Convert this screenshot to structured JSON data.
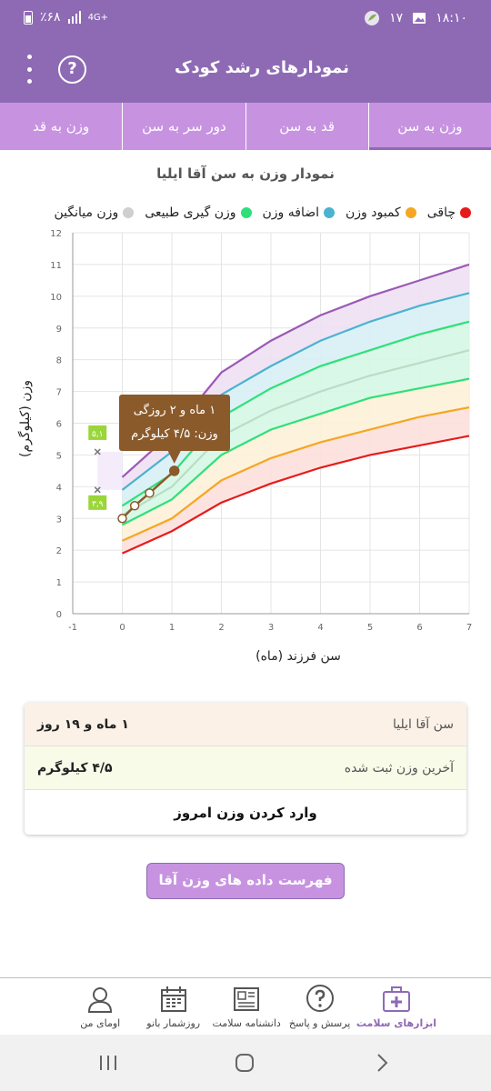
{
  "status_bar": {
    "time": "۱۸:۱۰",
    "date_num": "۱۷",
    "battery": "٪۶۸",
    "network": "4G+"
  },
  "app_bar": {
    "title": "نمودارهای رشد کودک"
  },
  "tabs": [
    {
      "label": "وزن به سن",
      "active": true
    },
    {
      "label": "قد به سن",
      "active": false
    },
    {
      "label": "دور سر به سن",
      "active": false
    },
    {
      "label": "وزن به قد",
      "active": false
    }
  ],
  "chart_title": "نمودار وزن به سن آقا ایلیا",
  "legend": [
    {
      "label": "چاقی",
      "color": "#e51c1c"
    },
    {
      "label": "کمبود وزن",
      "color": "#f5a623"
    },
    {
      "label": "اضافه وزن",
      "color": "#4ab3d0"
    },
    {
      "label": "وزن گیری طبیعی",
      "color": "#2ee07a"
    },
    {
      "label": "وزن میانگین",
      "color": "#cfcfcf"
    }
  ],
  "chart_data": {
    "type": "line",
    "xlabel": "سن فرزند (ماه)",
    "ylabel": "وزن (کیلوگرم)",
    "xlim": [
      -1,
      7
    ],
    "ylim": [
      0,
      12
    ],
    "x_ticks": [
      "-1",
      "0",
      "1",
      "2",
      "3",
      "4",
      "5",
      "6",
      "7"
    ],
    "y_ticks": [
      "0",
      "1",
      "2",
      "3",
      "4",
      "5",
      "6",
      "7",
      "8",
      "9",
      "10",
      "11",
      "12"
    ],
    "x": [
      0,
      1,
      2,
      3,
      4,
      5,
      6,
      7
    ],
    "series": [
      {
        "color": "#9b59b6",
        "values": [
          4.3,
          5.7,
          7.6,
          8.6,
          9.4,
          10.0,
          10.5,
          11.0
        ]
      },
      {
        "color": "#4ab3d0",
        "values": [
          3.9,
          5.1,
          6.9,
          7.8,
          8.6,
          9.2,
          9.7,
          10.1
        ]
      },
      {
        "color": "#2ee07a",
        "values": [
          3.4,
          4.4,
          6.2,
          7.1,
          7.8,
          8.3,
          8.8,
          9.2
        ]
      },
      {
        "color": "#b9ddc6",
        "values": [
          3.1,
          4.0,
          5.6,
          6.4,
          7.0,
          7.5,
          7.9,
          8.3
        ]
      },
      {
        "color": "#2ee07a",
        "values": [
          2.8,
          3.6,
          5.0,
          5.8,
          6.3,
          6.8,
          7.1,
          7.4
        ]
      },
      {
        "color": "#f5a623",
        "values": [
          2.3,
          3.0,
          4.2,
          4.9,
          5.4,
          5.8,
          6.2,
          6.5
        ]
      },
      {
        "color": "#e51c1c",
        "values": [
          1.9,
          2.6,
          3.5,
          4.1,
          4.6,
          5.0,
          5.3,
          5.6
        ]
      }
    ],
    "band_fills": [
      "#ede0f3",
      "#d8eff5",
      "#d6f7e4",
      "#d6f7e4",
      "#fdf1d8",
      "#fde0dc"
    ],
    "child_series": {
      "color": "#8b5a2b",
      "x": [
        0,
        0.25,
        0.55,
        1.05
      ],
      "values": [
        3.0,
        3.4,
        3.8,
        4.5
      ]
    },
    "birth_range": {
      "low": 3.9,
      "high": 5.1,
      "low_label": "۳,۹",
      "high_label": "۵,۱"
    },
    "tooltip": {
      "line1": "۱ ماه و ۲ روزگی",
      "line2": "وزن: ۴/۵ کیلوگرم"
    }
  },
  "info": {
    "age_label": "سن آقا ایلیا",
    "age_value": "۱ ماه و ۱۹ روز",
    "weight_label": "آخرین وزن ثبت شده",
    "weight_value": "۴/۵ کیلوگرم",
    "enter_button": "وارد کردن وزن امروز"
  },
  "list_button": "فهرست داده های وزن آقا ایلیا",
  "bottom_nav": [
    {
      "label": "ابزارهای سلامت",
      "icon": "medical-kit-icon",
      "active": true
    },
    {
      "label": "پرسش و پاسخ",
      "icon": "question-bubble-icon",
      "active": false
    },
    {
      "label": "دانشنامه سلامت",
      "icon": "newspaper-icon",
      "active": false
    },
    {
      "label": "روزشمار بانو",
      "icon": "calendar-icon",
      "active": false
    },
    {
      "label": "اومای من",
      "icon": "profile-icon",
      "active": false
    }
  ]
}
